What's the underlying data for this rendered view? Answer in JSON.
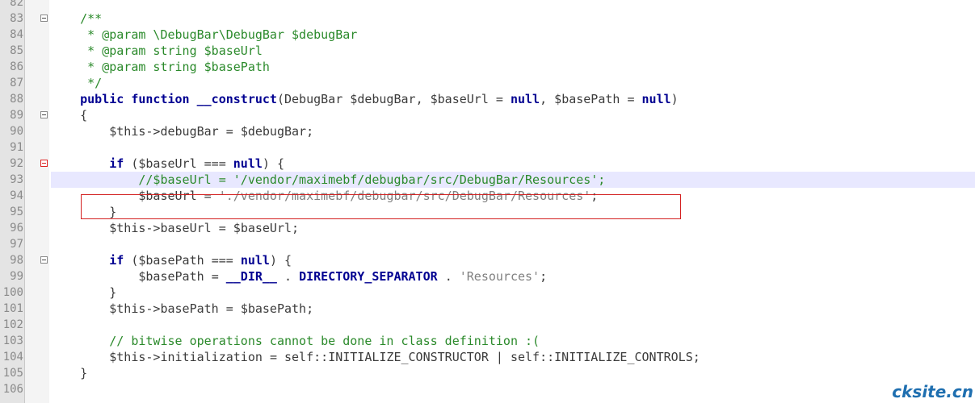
{
  "editor": {
    "lines": [
      {
        "n": "82",
        "code": ""
      },
      {
        "n": "83",
        "fold": "normal",
        "code": "    /**"
      },
      {
        "n": "84",
        "code": "     * @param \\DebugBar\\DebugBar $debugBar"
      },
      {
        "n": "85",
        "code": "     * @param string $baseUrl"
      },
      {
        "n": "86",
        "code": "     * @param string $basePath"
      },
      {
        "n": "87",
        "code": "     */"
      },
      {
        "n": "88",
        "code": "    public function __construct(DebugBar $debugBar, $baseUrl = null, $basePath = null)"
      },
      {
        "n": "89",
        "fold": "normal",
        "code": "    {"
      },
      {
        "n": "90",
        "code": "        $this->debugBar = $debugBar;"
      },
      {
        "n": "91",
        "code": ""
      },
      {
        "n": "92",
        "fold": "red",
        "code": "        if ($baseUrl === null) {"
      },
      {
        "n": "93",
        "highlight": true,
        "code": "            //$baseUrl = '/vendor/maximebf/debugbar/src/DebugBar/Resources';"
      },
      {
        "n": "94",
        "code": "            $baseUrl = './vendor/maximebf/debugbar/src/DebugBar/Resources';"
      },
      {
        "n": "95",
        "code": "        }"
      },
      {
        "n": "96",
        "code": "        $this->baseUrl = $baseUrl;"
      },
      {
        "n": "97",
        "code": ""
      },
      {
        "n": "98",
        "fold": "normal",
        "code": "        if ($basePath === null) {"
      },
      {
        "n": "99",
        "code": "            $basePath = __DIR__ . DIRECTORY_SEPARATOR . 'Resources';"
      },
      {
        "n": "100",
        "code": "        }"
      },
      {
        "n": "101",
        "code": "        $this->basePath = $basePath;"
      },
      {
        "n": "102",
        "code": ""
      },
      {
        "n": "103",
        "code": "        // bitwise operations cannot be done in class definition :("
      },
      {
        "n": "104",
        "code": "        $this->initialization = self::INITIALIZE_CONSTRUCTOR | self::INITIALIZE_CONTROLS;"
      },
      {
        "n": "105",
        "code": "    }"
      },
      {
        "n": "106",
        "code": ""
      }
    ]
  },
  "colors": {
    "keyword": "#000091",
    "comment": "#2b8a2b",
    "string": "#808080",
    "highlight_box": "#d32020",
    "current_line": "#e8e8ff"
  },
  "watermark": "cksite.cn"
}
